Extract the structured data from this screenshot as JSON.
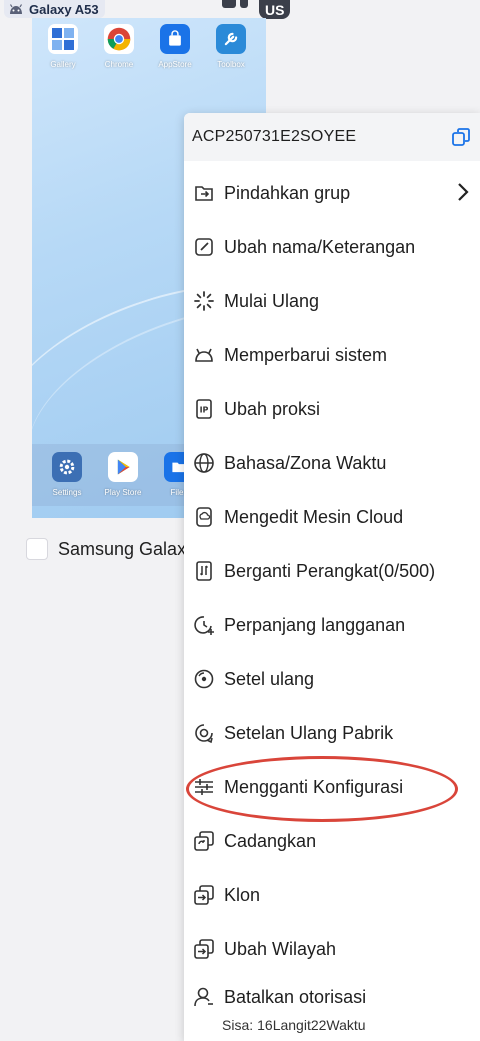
{
  "device": {
    "name": "Galaxy A53",
    "region": "US",
    "apps": [
      {
        "label": "Gallery",
        "icon": "gallery-icon",
        "color": "#2f6fd6"
      },
      {
        "label": "Chrome",
        "icon": "chrome-icon",
        "color": "#ffffff"
      },
      {
        "label": "AppStore",
        "icon": "appstore-icon",
        "color": "#1a73e8"
      },
      {
        "label": "Toolbox",
        "icon": "toolbox-icon",
        "color": "#2b8ad8"
      }
    ],
    "dock_apps": [
      {
        "label": "Settings",
        "icon": "settings-icon"
      },
      {
        "label": "Play Store",
        "icon": "playstore-icon"
      },
      {
        "label": "Files",
        "icon": "files-icon"
      }
    ],
    "card_label": "Samsung Galax"
  },
  "menu": {
    "device_id": "ACP250731E2SOYEE",
    "items": [
      {
        "label": "Pindahkan grup",
        "icon": "move-group-icon"
      },
      {
        "label": "Ubah nama/Keterangan",
        "icon": "edit-icon"
      },
      {
        "label": "Mulai Ulang",
        "icon": "restart-icon"
      },
      {
        "label": "Memperbarui sistem",
        "icon": "android-icon"
      },
      {
        "label": "Ubah proksi",
        "icon": "proxy-icon"
      },
      {
        "label": "Bahasa/Zona Waktu",
        "icon": "globe-icon"
      },
      {
        "label": "Mengedit Mesin Cloud",
        "icon": "cloud-machine-icon"
      },
      {
        "label": "Berganti Perangkat(0/500)",
        "icon": "switch-device-icon"
      },
      {
        "label": "Perpanjang langganan",
        "icon": "renew-icon"
      },
      {
        "label": "Setel ulang",
        "icon": "reset-icon"
      },
      {
        "label": "Setelan Ulang Pabrik",
        "icon": "factory-reset-icon"
      },
      {
        "label": "Mengganti Konfigurasi",
        "icon": "sliders-icon"
      },
      {
        "label": "Cadangkan",
        "icon": "backup-icon"
      },
      {
        "label": "Klon",
        "icon": "clone-icon"
      },
      {
        "label": "Ubah Wilayah",
        "icon": "region-icon"
      },
      {
        "label": "Batalkan otorisasi",
        "icon": "user-icon"
      }
    ],
    "remaining_label": "Sisa:",
    "remaining_value": "16Langit22Waktu"
  },
  "colors": {
    "annotation": "#d9453a",
    "accent": "#1a73e8"
  }
}
